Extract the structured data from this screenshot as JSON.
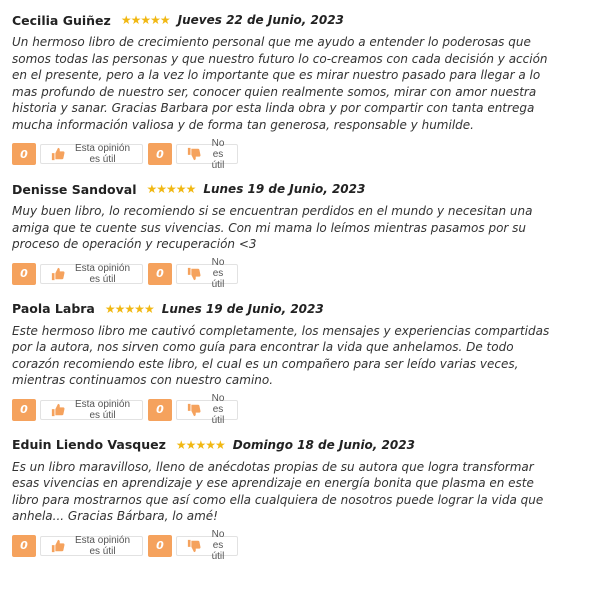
{
  "reviews": [
    {
      "name": "Cecilia Guiñez",
      "rating": 5,
      "date": "Jueves 22 de Junio, 2023",
      "text": "Un hermoso libro de crecimiento personal que me ayudo a entender lo poderosas que somos todas las personas y que nuestro futuro lo co-creamos con cada decisión y acción en el presente, pero a la vez lo importante que es mirar nuestro pasado para llegar a lo mas profundo de nuestro ser, conocer quien realmente somos, mirar con amor nuestra historia y sanar. Gracias Barbara por esta linda obra y por compartir con tanta entrega mucha información valiosa y de forma tan generosa, responsable y humilde.",
      "useful_count": "0",
      "useful_label": "Esta opinión es útil",
      "not_useful_count": "0",
      "not_useful_label": "No es útil"
    },
    {
      "name": "Denisse Sandoval",
      "rating": 5,
      "date": "Lunes 19 de Junio, 2023",
      "text": "Muy buen libro, lo recomiendo si se encuentran perdidos en el mundo y necesitan una amiga que te cuente sus vivencias. Con mi mama lo leímos mientras pasamos por su proceso de operación y recuperación <3",
      "useful_count": "0",
      "useful_label": "Esta opinión es útil",
      "not_useful_count": "0",
      "not_useful_label": "No es útil"
    },
    {
      "name": "Paola Labra",
      "rating": 5,
      "date": "Lunes 19 de Junio, 2023",
      "text": "Este hermoso libro me cautivó completamente, los mensajes y experiencias compartidas por la autora, nos sirven como guía para encontrar la vida que anhelamos. De todo corazón recomiendo este libro, el cual es un compañero para ser leído varias veces, mientras continuamos con nuestro camino.",
      "useful_count": "0",
      "useful_label": "Esta opinión es útil",
      "not_useful_count": "0",
      "not_useful_label": "No es útil"
    },
    {
      "name": "Eduin Liendo Vasquez",
      "rating": 5,
      "date": "Domingo 18 de Junio, 2023",
      "text": "Es un libro maravilloso, lleno de anécdotas propias de su autora que logra transformar esas vivencias en aprendizaje y ese aprendizaje en energía bonita que plasma en este libro para mostrarnos que así como ella cualquiera de nosotros puede lograr la vida que anhela... Gracias Bárbara, lo amé!",
      "useful_count": "0",
      "useful_label": "Esta opinión es útil",
      "not_useful_count": "0",
      "not_useful_label": "No es útil"
    }
  ],
  "colors": {
    "star": "#f1b813",
    "count_badge": "#f5a25d",
    "thumbs_up": "#f5a25d",
    "thumbs_down": "#f5a25d"
  },
  "icons": {
    "star": "star-icon",
    "thumbs_up": "thumbs-up-icon",
    "thumbs_down": "thumbs-down-icon"
  }
}
